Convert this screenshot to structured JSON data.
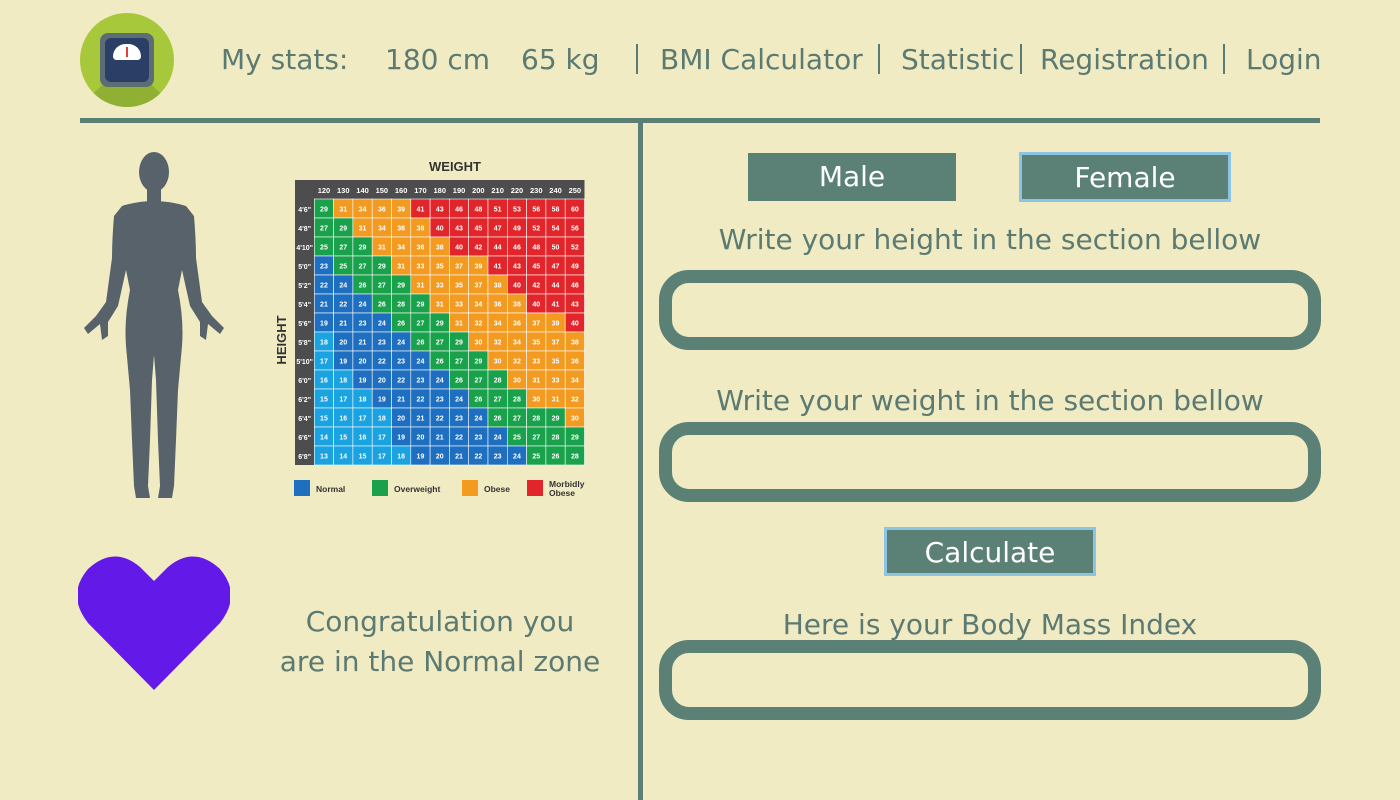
{
  "header": {
    "stats_label": "My stats:",
    "height_value": "180 cm",
    "weight_value": "65 kg",
    "nav": {
      "bmi_calculator": "BMI Calculator",
      "statistic": "Statistic",
      "registration": "Registration",
      "login": "Login"
    }
  },
  "bmi_chart": {
    "title_weight": "WEIGHT",
    "title_height": "HEIGHT",
    "weights": [
      "120",
      "130",
      "140",
      "150",
      "160",
      "170",
      "180",
      "190",
      "200",
      "210",
      "220",
      "230",
      "240",
      "250"
    ],
    "heights": [
      "4'6\"",
      "4'8\"",
      "4'10\"",
      "5'0\"",
      "5'2\"",
      "5'4\"",
      "5'6\"",
      "5'8\"",
      "5'10\"",
      "6'0\"",
      "6'2\"",
      "6'4\"",
      "6'6\"",
      "6'8\""
    ],
    "values": [
      [
        29,
        31,
        34,
        36,
        39,
        41,
        43,
        46,
        48,
        51,
        53,
        56,
        58,
        60
      ],
      [
        27,
        29,
        31,
        34,
        36,
        38,
        40,
        43,
        45,
        47,
        49,
        52,
        54,
        56
      ],
      [
        25,
        27,
        29,
        31,
        34,
        36,
        38,
        40,
        42,
        44,
        46,
        48,
        50,
        52
      ],
      [
        23,
        25,
        27,
        29,
        31,
        33,
        35,
        37,
        39,
        41,
        43,
        45,
        47,
        49
      ],
      [
        22,
        24,
        26,
        27,
        29,
        31,
        33,
        35,
        37,
        38,
        40,
        42,
        44,
        46
      ],
      [
        21,
        22,
        24,
        26,
        28,
        29,
        31,
        33,
        34,
        36,
        38,
        40,
        41,
        43
      ],
      [
        19,
        21,
        23,
        24,
        26,
        27,
        29,
        31,
        32,
        34,
        36,
        37,
        39,
        40
      ],
      [
        18,
        20,
        21,
        23,
        24,
        26,
        27,
        29,
        30,
        32,
        34,
        35,
        37,
        38
      ],
      [
        17,
        19,
        20,
        22,
        23,
        24,
        26,
        27,
        29,
        30,
        32,
        33,
        35,
        36
      ],
      [
        16,
        18,
        19,
        20,
        22,
        23,
        24,
        26,
        27,
        28,
        30,
        31,
        33,
        34
      ],
      [
        15,
        17,
        18,
        19,
        21,
        22,
        23,
        24,
        26,
        27,
        28,
        30,
        31,
        32
      ],
      [
        15,
        16,
        17,
        18,
        20,
        21,
        22,
        23,
        24,
        26,
        27,
        28,
        29,
        30
      ],
      [
        14,
        15,
        16,
        17,
        19,
        20,
        21,
        22,
        23,
        24,
        25,
        27,
        28,
        29
      ],
      [
        13,
        14,
        15,
        17,
        18,
        19,
        20,
        21,
        22,
        23,
        24,
        25,
        26,
        28
      ]
    ],
    "legend": [
      {
        "label": "Normal",
        "color": "#1f6fc1"
      },
      {
        "label": "Overweight",
        "color": "#19a24b"
      },
      {
        "label": "Obese",
        "color": "#f39a21"
      },
      {
        "label": "Morbidly Obese",
        "color": "#e2252a"
      }
    ],
    "underweight_color": "#1aa3e0",
    "header_color": "#4d4d4d"
  },
  "result_message": {
    "line1": "Congratulation you",
    "line2": "are in the Normal zone"
  },
  "form": {
    "male_label": "Male",
    "female_label": "Female",
    "height_prompt": "Write your height in the section bellow",
    "height_value": "",
    "weight_prompt": "Write your weight in the section bellow",
    "weight_value": "",
    "calculate_label": "Calculate",
    "result_prompt": "Here is your Body Mass Index",
    "result_value": ""
  },
  "colors": {
    "background": "#f1ebc4",
    "accent": "#5b8075",
    "text": "#5b7a72",
    "heart": "#6319e8",
    "silhouette": "#58626a",
    "selected_border": "#8cc4e6"
  }
}
